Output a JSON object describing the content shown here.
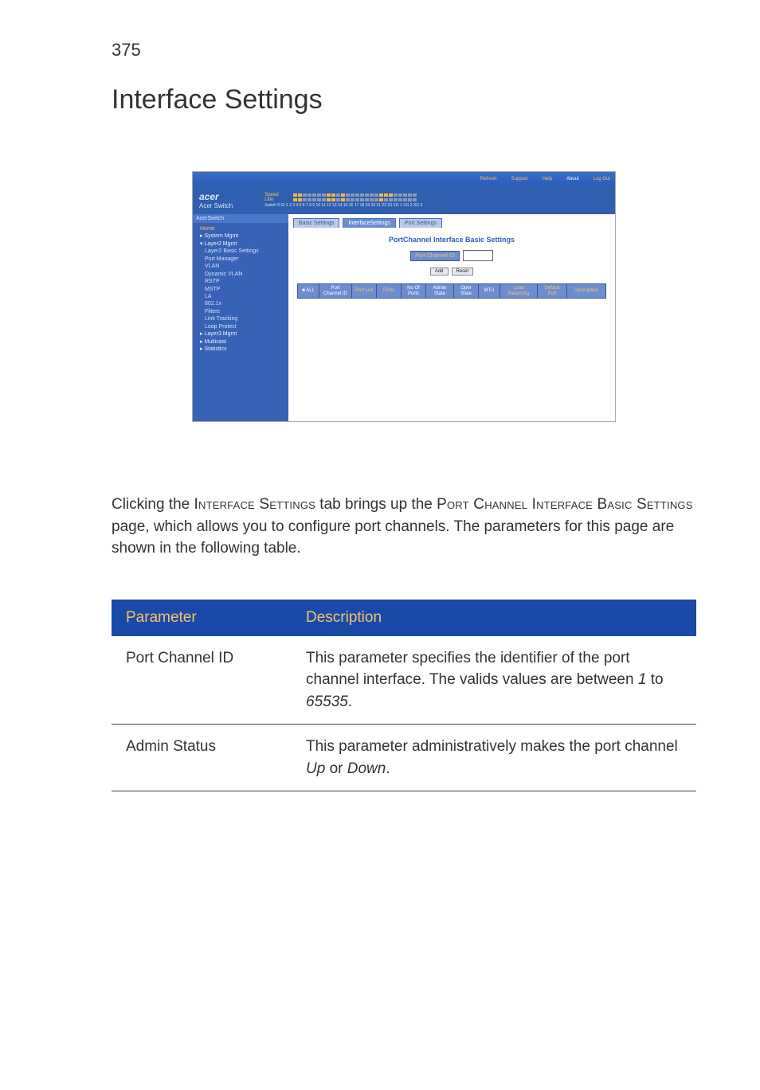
{
  "page_number": "375",
  "page_title": "Interface Settings",
  "figure": {
    "top_links": [
      "Refresh",
      "Support",
      "Help",
      "About",
      "Log Out"
    ],
    "brand_logo": "acer",
    "brand_sub": "Acer Switch",
    "speed_label": "Speed",
    "link_label": "Link",
    "switch_numbers": "Switch 0 Gi 1 2 3 4 5 6 7 8 9 10 11 12 13 14 15 16 17 18 19 20 21 22 23 XG 1 XG 2 XG 3",
    "side_title": "AcerSwitch",
    "side_items": [
      {
        "label": "Home",
        "cls": "orange-item li1"
      },
      {
        "label": "▸ System Mgmt",
        "cls": "li1"
      },
      {
        "label": "▾ Layer2 Mgmt",
        "cls": "li1"
      },
      {
        "label": "Layer2 Basic Settings",
        "cls": "li2"
      },
      {
        "label": "Port Manager",
        "cls": "li2"
      },
      {
        "label": "VLAN",
        "cls": "li2"
      },
      {
        "label": "Dynamic VLAN",
        "cls": "li2"
      },
      {
        "label": "RSTP",
        "cls": "li2"
      },
      {
        "label": "MSTP",
        "cls": "li2"
      },
      {
        "label": "LA",
        "cls": "li2"
      },
      {
        "label": "802.1x",
        "cls": "li2"
      },
      {
        "label": "Filters",
        "cls": "li2"
      },
      {
        "label": "Link Tracking",
        "cls": "li2"
      },
      {
        "label": "Loop Protect",
        "cls": "li2"
      },
      {
        "label": "▸ Layer3 Mgmt",
        "cls": "li1"
      },
      {
        "label": "▸ Multicast",
        "cls": "li1"
      },
      {
        "label": "▸ Statistics",
        "cls": "li1"
      }
    ],
    "tabs": [
      "Basic Settings",
      "InterfaceSettings",
      "Port Settings"
    ],
    "panel_title": "PortChannel Interface Basic Settings",
    "pcid_label": "Port Channel ID",
    "btn_add": "Add",
    "btn_reset": "Reset",
    "grid_headers": [
      "■ ALL",
      "Port Channel ID",
      "Port List",
      "Ports",
      "No Of Ports",
      "Admin State",
      "Oper State",
      "MTU",
      "Load Balancing",
      "Default Port",
      "Description"
    ]
  },
  "body_parts": {
    "p1a": "Clicking the ",
    "p1b": "Interface Settings",
    "p1c": " tab brings up the ",
    "p1d": "Port Channel Interface Basic Settings",
    "p1e": " page, which allows you to configure port channels. The parameters for this page are shown in the following table."
  },
  "table": {
    "head_param": "Parameter",
    "head_desc": "Description",
    "rows": [
      {
        "param": "Port Channel ID",
        "desc_a": "This parameter specifies the identifier of the port channel interface. The valids values are between ",
        "desc_b": "1",
        "desc_c": " to ",
        "desc_d": "65535",
        "desc_e": "."
      },
      {
        "param": "Admin Status",
        "desc_a": "This parameter administratively makes the port channel ",
        "desc_b": "Up",
        "desc_c": " or ",
        "desc_d": "Down",
        "desc_e": "."
      }
    ]
  }
}
